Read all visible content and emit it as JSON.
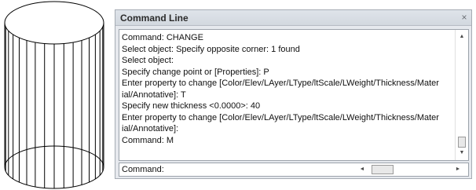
{
  "window": {
    "title": "Command Line",
    "close_glyph": "×"
  },
  "history": {
    "lines": [
      "Command: CHANGE",
      "Select object: Specify opposite corner: 1 found",
      "Select object:",
      "Specify change point or [Properties]: P",
      "Enter property to change [Color/Elev/LAyer/LType/ltScale/LWeight/Thickness/Mater",
      "ial/Annotative]: T",
      "Specify new thickness <0.0000>: 40",
      "Enter property to change [Color/Elev/LAyer/LType/ltScale/LWeight/Thickness/Mater",
      "ial/Annotative]:",
      "Command: M"
    ]
  },
  "input": {
    "value": "Command:"
  },
  "scrollbars": {
    "up_glyph": "▲",
    "down_glyph": "▼",
    "left_glyph": "◄",
    "right_glyph": "►"
  },
  "icons": {
    "close": "close-icon",
    "scroll_up": "scroll-up-arrow-icon",
    "scroll_down": "scroll-down-arrow-icon",
    "scroll_left": "scroll-left-arrow-icon",
    "scroll_right": "scroll-right-arrow-icon"
  },
  "colors": {
    "window_bg": "#e6e9ee",
    "titlebar": "#d8dde3",
    "text": "#111111",
    "cylinder_stroke": "#000000"
  }
}
